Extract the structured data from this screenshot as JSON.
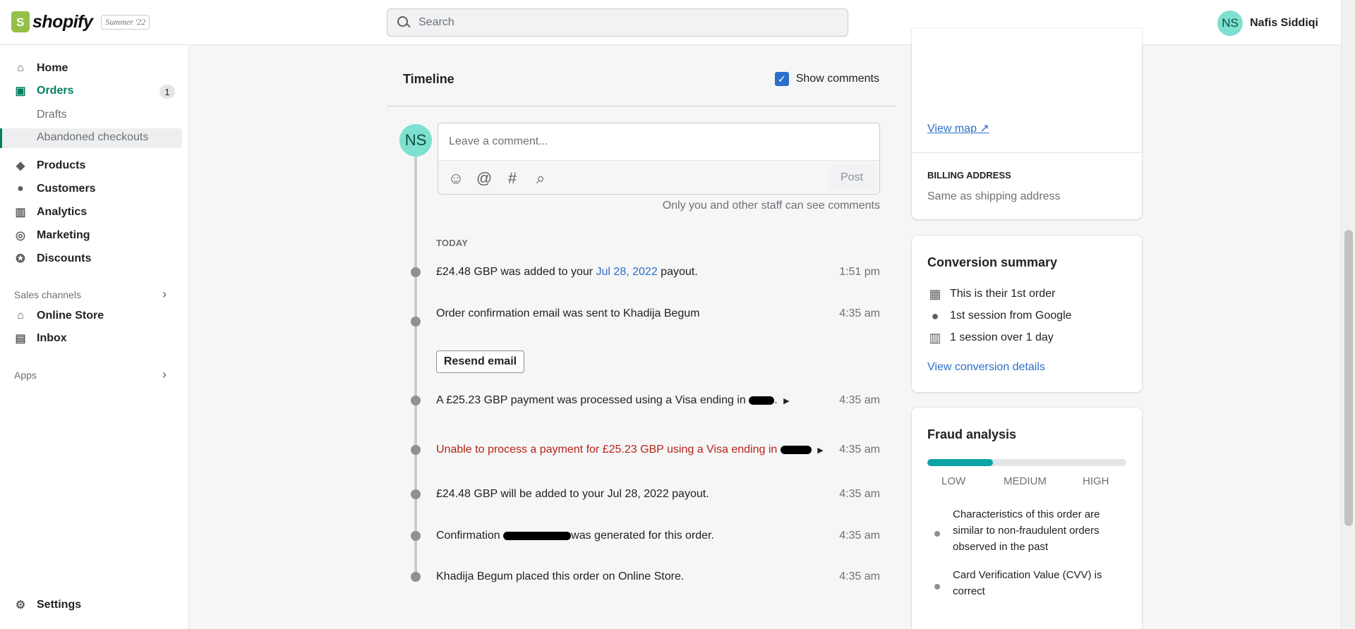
{
  "header": {
    "brand": "shopify",
    "edition": "Summer '22",
    "search_placeholder": "Search",
    "user_initials": "NS",
    "user_name": "Nafis Siddiqi"
  },
  "sidebar": {
    "items": [
      {
        "label": "Home",
        "icon": "home-icon"
      },
      {
        "label": "Orders",
        "icon": "orders-icon",
        "badge": "1"
      },
      {
        "label": "Drafts"
      },
      {
        "label": "Abandoned checkouts"
      },
      {
        "label": "Products",
        "icon": "tag-icon"
      },
      {
        "label": "Customers",
        "icon": "person-icon"
      },
      {
        "label": "Analytics",
        "icon": "bar-chart-icon"
      },
      {
        "label": "Marketing",
        "icon": "target-icon"
      },
      {
        "label": "Discounts",
        "icon": "discount-icon"
      }
    ],
    "sales_channels_title": "Sales channels",
    "channels": [
      {
        "label": "Online Store",
        "icon": "store-icon"
      },
      {
        "label": "Inbox",
        "icon": "inbox-icon"
      }
    ],
    "apps_title": "Apps",
    "settings_label": "Settings"
  },
  "timeline": {
    "title": "Timeline",
    "show_comments_label": "Show comments",
    "avatar_initials": "NS",
    "comment_placeholder": "Leave a comment...",
    "post_label": "Post",
    "comment_note": "Only you and other staff can see comments",
    "day_label": "TODAY",
    "events": [
      {
        "pre": "£24.48 GBP was added to your ",
        "link": "Jul 28, 2022",
        "post": " payout.",
        "time": "1:51 pm"
      },
      {
        "text": "Order confirmation email was sent to Khadija Begum",
        "time": "4:35 am",
        "button": "Resend email"
      },
      {
        "text": "A £25.23 GBP payment was processed using a Visa ending in",
        "time": "4:35 am"
      },
      {
        "text": "Unable to process a payment for £25.23 GBP using a Visa ending in",
        "time": "4:35 am",
        "error": true
      },
      {
        "text": "£24.48 GBP will be added to your Jul 28, 2022 payout.",
        "time": "4:35 am"
      },
      {
        "pre": "Confirmation ",
        "post": "was generated for this order.",
        "time": "4:35 am"
      },
      {
        "text": "Khadija Begum placed this order on Online Store.",
        "time": "4:35 am"
      }
    ]
  },
  "address_card": {
    "view_map_label": "View map",
    "billing_title": "BILLING ADDRESS",
    "billing_text": "Same as shipping address"
  },
  "conversion": {
    "title": "Conversion summary",
    "items": [
      {
        "text": "This is their 1st order",
        "icon": "calendar-icon"
      },
      {
        "text": "1st session from Google",
        "icon": "info-icon"
      },
      {
        "text": "1 session over 1 day",
        "icon": "session-icon"
      }
    ],
    "link": "View conversion details"
  },
  "fraud": {
    "title": "Fraud analysis",
    "risk_level": 0.33,
    "accent_color": "#0ba3a3",
    "labels": [
      "LOW",
      "MEDIUM",
      "HIGH"
    ],
    "items": [
      "Characteristics of this order are similar to non-fraudulent orders observed in the past",
      "Card Verification Value (CVV) is correct"
    ]
  }
}
